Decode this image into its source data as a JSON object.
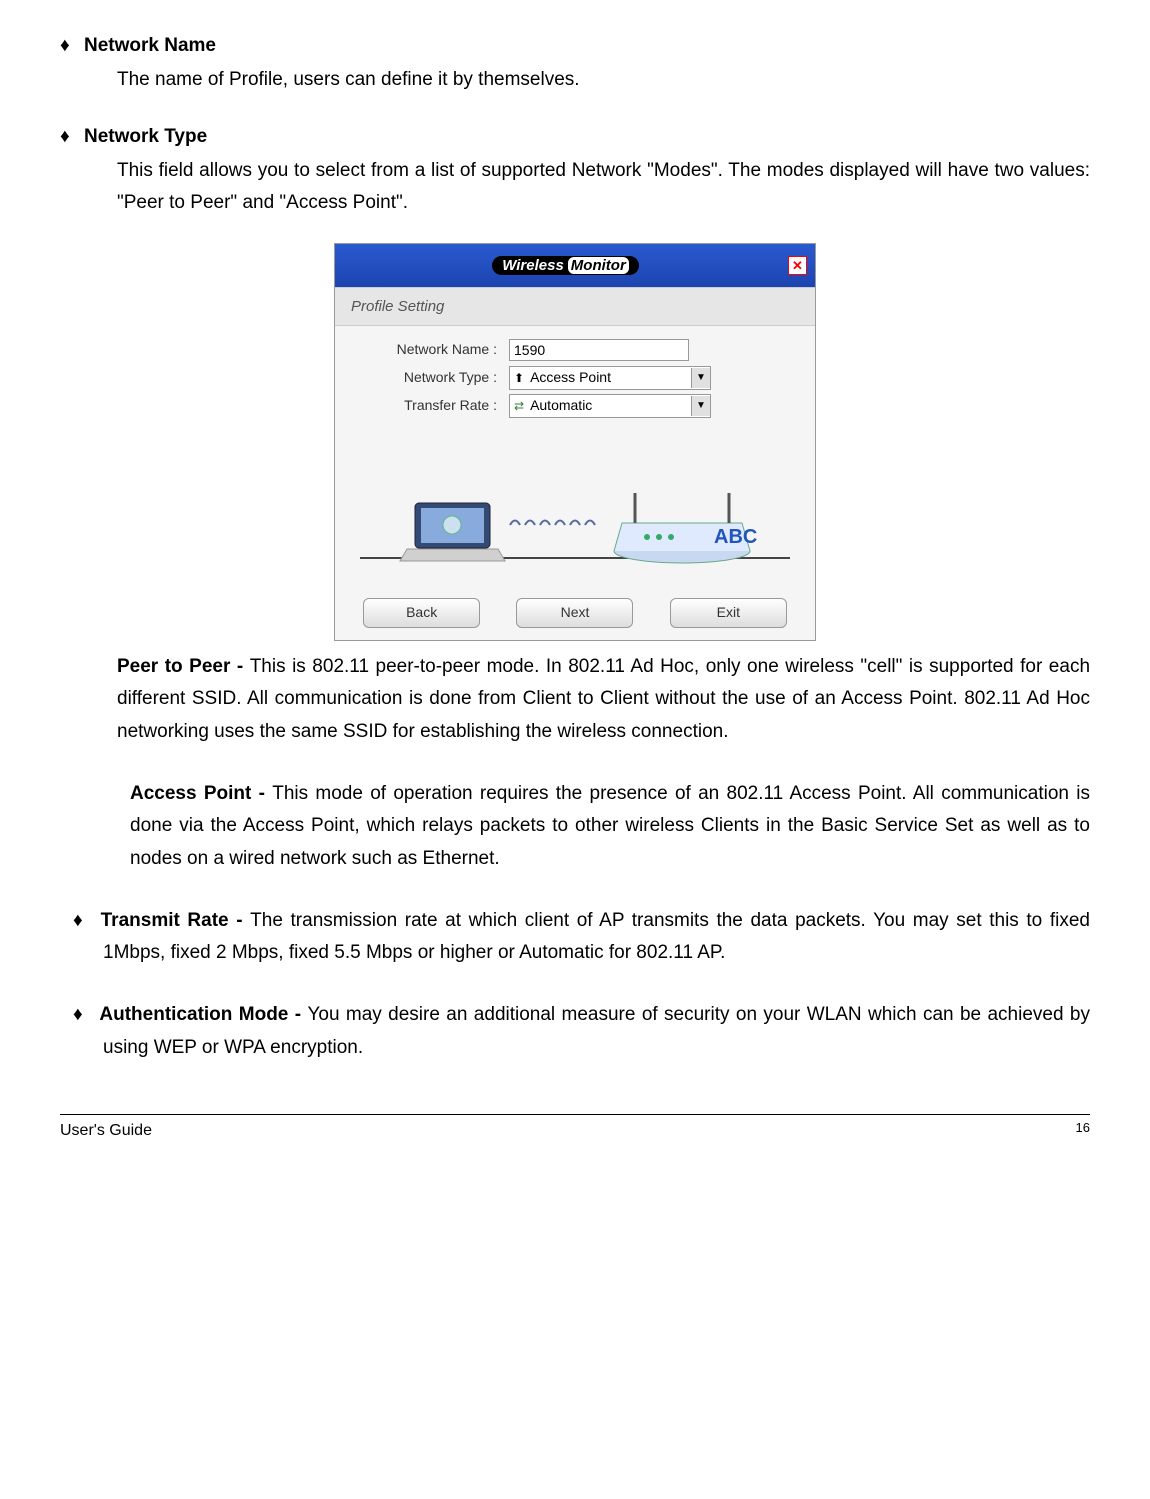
{
  "items": {
    "network_name": {
      "heading": "Network Name",
      "text": "The name of Profile, users can define it by themselves."
    },
    "network_type": {
      "heading": "Network Type",
      "text": "This field allows you to select from a list of supported Network \"Modes\".  The modes displayed will have two values:  \"Peer to Peer\" and \"Access Point\"."
    },
    "peer_to_peer": {
      "heading": "Peer to Peer   - ",
      "text": "This is 802.11 peer-to-peer mode. In 802.11 Ad Hoc, only one wireless \"cell\" is supported for each different SSID. All communication is done from Client to Client without the use of an Access Point. 802.11 Ad Hoc networking uses the same SSID for establishing the wireless connection."
    },
    "access_point": {
      "heading": "Access Point  - ",
      "text": "This mode of operation requires the presence of an 802.11 Access Point. All communication is done via the Access Point, which relays packets to other wireless Clients in the Basic Service Set as well as to nodes on a wired network such as Ethernet."
    },
    "transmit_rate": {
      "heading": "Transmit Rate - ",
      "text": "The transmission rate at which client of AP transmits the data packets. You may set this to fixed 1Mbps, fixed 2 Mbps, fixed 5.5 Mbps or higher or Automatic for 802.11 AP."
    },
    "auth_mode": {
      "heading": "Authentication Mode - ",
      "text": "You may desire an additional measure of security on your WLAN which can be achieved by using WEP or WPA encryption."
    }
  },
  "figure": {
    "title_word1": "Wireless",
    "title_word2": "Monitor",
    "subheader": "Profile Setting",
    "labels": {
      "network_name": "Network Name :",
      "network_type": "Network Type :",
      "transfer_rate": "Transfer Rate :"
    },
    "values": {
      "network_name": "1590",
      "network_type": "Access Point",
      "transfer_rate": "Automatic"
    },
    "illustration_label": "ABC",
    "buttons": {
      "back": "Back",
      "next": "Next",
      "exit": "Exit"
    }
  },
  "footer": {
    "left": " User's Guide",
    "right": "16"
  },
  "bullet_char": "♦"
}
